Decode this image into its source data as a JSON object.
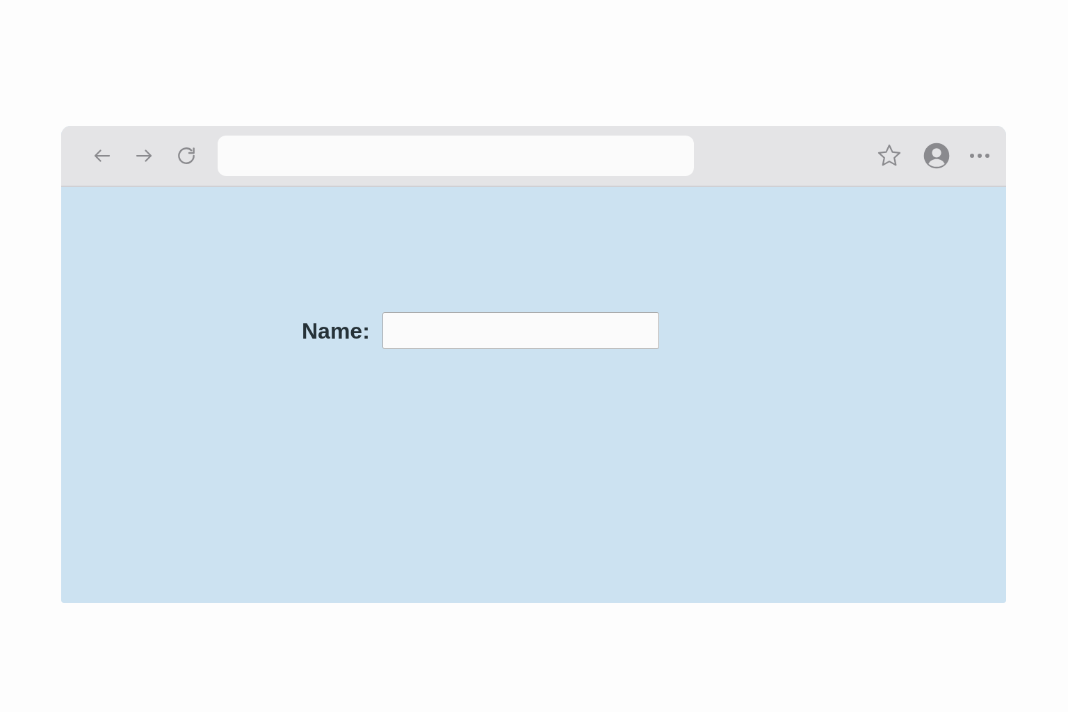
{
  "form": {
    "label": "Name:"
  }
}
